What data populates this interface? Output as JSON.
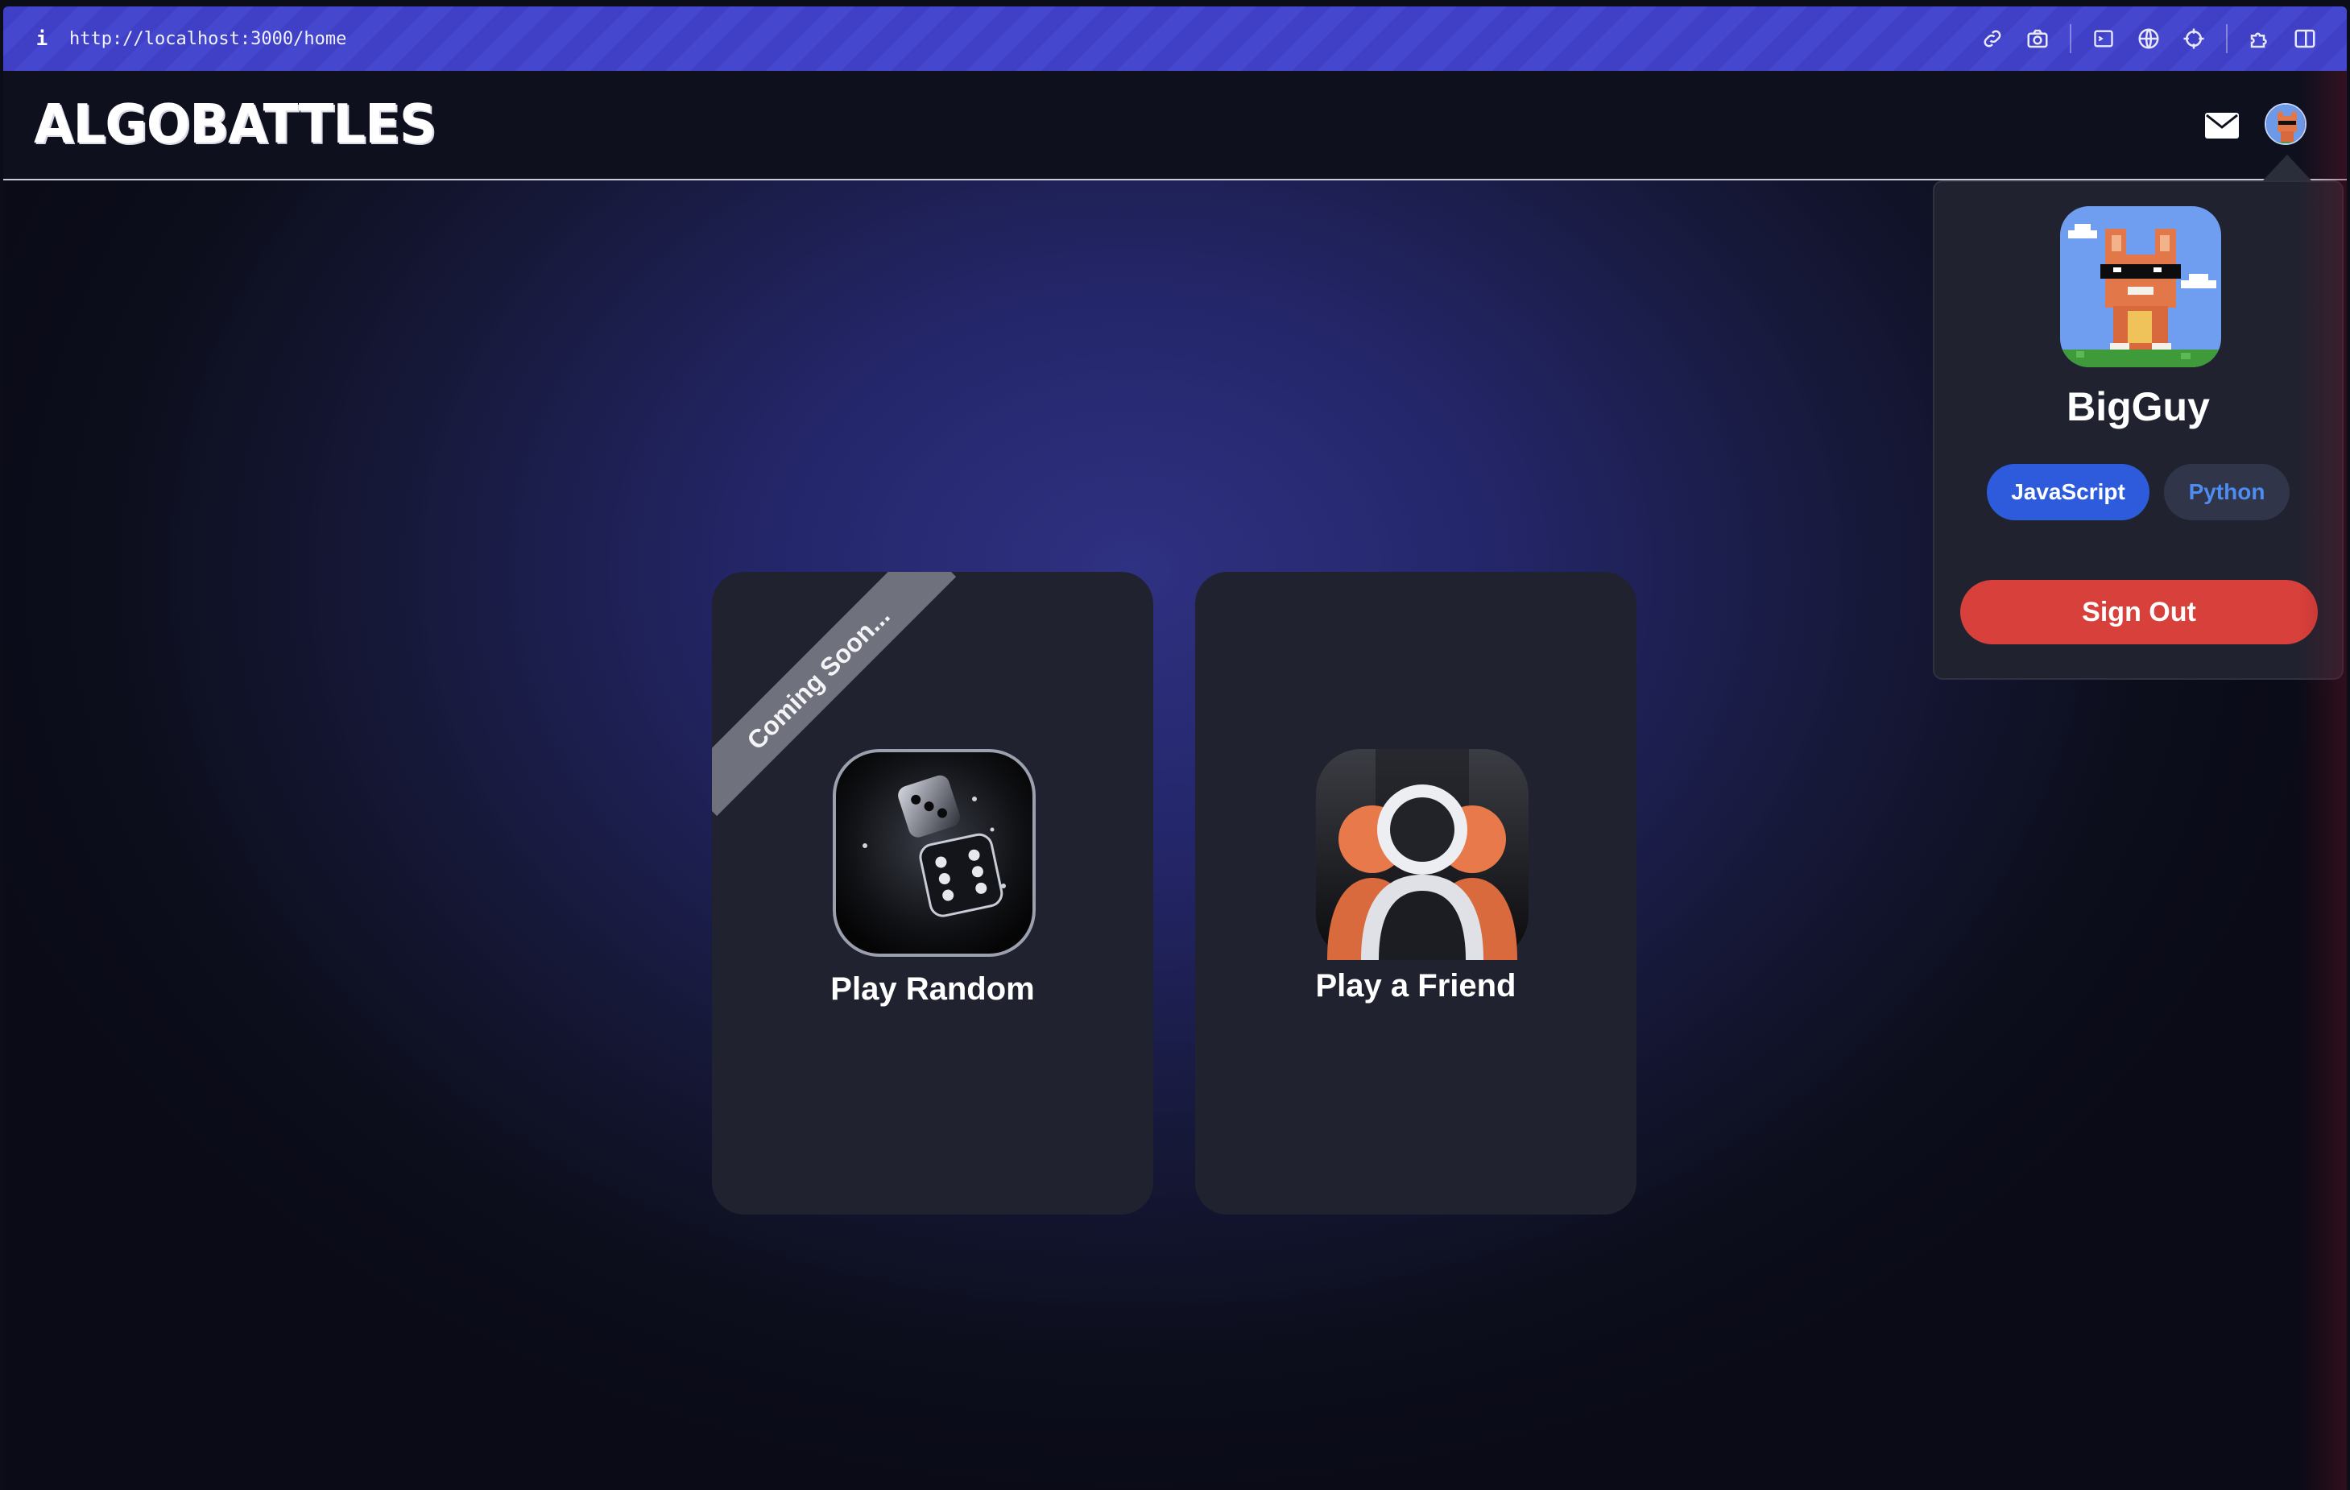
{
  "browser": {
    "info_icon": "i",
    "url": "http://localhost:3000/home",
    "toolbar_icons": [
      "link-icon",
      "camera-icon",
      "terminal-icon",
      "globe-icon",
      "crosshair-icon",
      "puzzle-icon",
      "split-view-icon"
    ]
  },
  "header": {
    "logo": "ALGOBATTLES",
    "icons": [
      "mail-icon",
      "avatar"
    ]
  },
  "cards": [
    {
      "title": "Play Random",
      "ribbon": "Coming Soon...",
      "icon": "dice-icon"
    },
    {
      "title": "Play a Friend",
      "icon": "friends-icon"
    }
  ],
  "profile_menu": {
    "username": "BigGuy",
    "languages": [
      {
        "label": "JavaScript",
        "selected": true
      },
      {
        "label": "Python",
        "selected": false
      }
    ],
    "sign_out_label": "Sign Out"
  },
  "colors": {
    "accent_blue": "#2e5bdc",
    "danger_red": "#d8403b",
    "card_bg": "#20232f",
    "url_bar": "#3f40c6"
  }
}
